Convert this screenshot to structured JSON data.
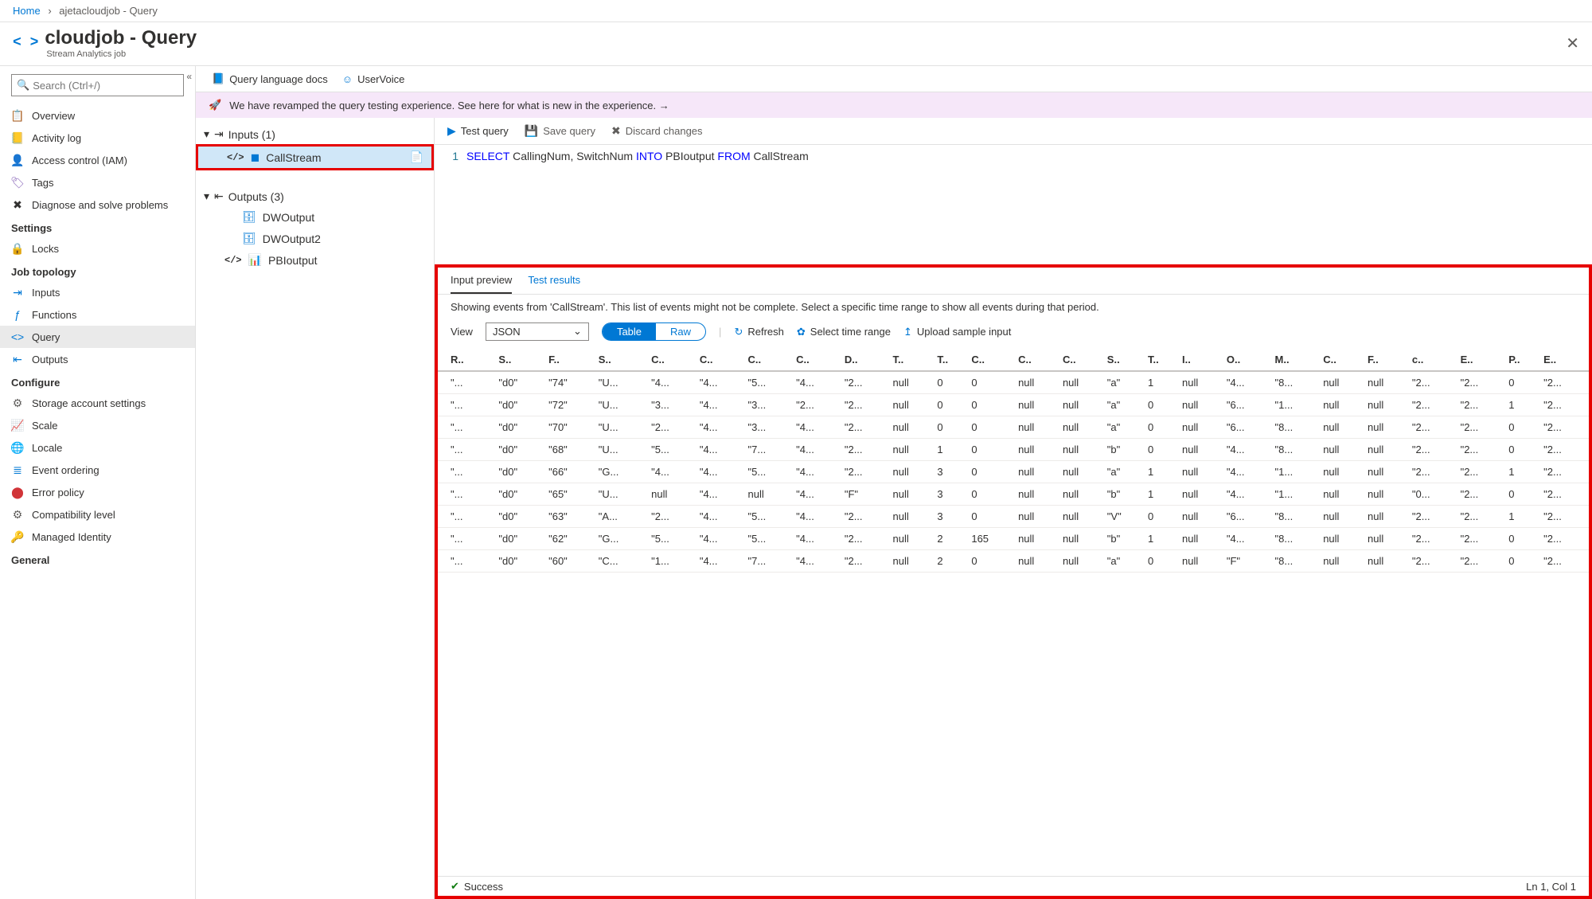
{
  "breadcrumb": {
    "home": "Home",
    "current": "ajetacloudjob - Query"
  },
  "header": {
    "title": "cloudjob - Query",
    "subtitle": "Stream Analytics job"
  },
  "sidebar": {
    "search_placeholder": "Search (Ctrl+/)",
    "items_main": [
      {
        "label": "Overview",
        "icon": "📋",
        "cls": "ic-blue"
      },
      {
        "label": "Activity log",
        "icon": "📒",
        "cls": "ic-blue"
      },
      {
        "label": "Access control (IAM)",
        "icon": "👤",
        "cls": "ic-blue"
      },
      {
        "label": "Tags",
        "icon": "🏷",
        "cls": "ic-purple"
      },
      {
        "label": "Diagnose and solve problems",
        "icon": "✖",
        "cls": "ic-dark"
      }
    ],
    "section_settings": "Settings",
    "items_settings": [
      {
        "label": "Locks",
        "icon": "🔒",
        "cls": "ic-dark"
      }
    ],
    "section_topology": "Job topology",
    "items_topology": [
      {
        "label": "Inputs",
        "icon": "⇥",
        "cls": "ic-blue"
      },
      {
        "label": "Functions",
        "icon": "ƒ",
        "cls": "ic-blue"
      },
      {
        "label": "Query",
        "icon": "<>",
        "cls": "ic-blue",
        "active": true
      },
      {
        "label": "Outputs",
        "icon": "⇤",
        "cls": "ic-blue"
      }
    ],
    "section_configure": "Configure",
    "items_configure": [
      {
        "label": "Storage account settings",
        "icon": "⚙",
        "cls": "ic-gray"
      },
      {
        "label": "Scale",
        "icon": "📈",
        "cls": "ic-blue"
      },
      {
        "label": "Locale",
        "icon": "🌐",
        "cls": "ic-teal"
      },
      {
        "label": "Event ordering",
        "icon": "≣",
        "cls": "ic-blue"
      },
      {
        "label": "Error policy",
        "icon": "⬤",
        "cls": "ic-red"
      },
      {
        "label": "Compatibility level",
        "icon": "⚙",
        "cls": "ic-gray"
      },
      {
        "label": "Managed Identity",
        "icon": "🔑",
        "cls": "ic-yellow"
      }
    ],
    "section_general": "General"
  },
  "top_toolbar": {
    "docs": "Query language docs",
    "uservoice": "UserVoice"
  },
  "banner": "We have revamped the query testing experience. See here for what is new in the experience. →",
  "tree": {
    "inputs_label": "Inputs (1)",
    "inputs": [
      {
        "label": "CallStream",
        "selected": true
      }
    ],
    "outputs_label": "Outputs (3)",
    "outputs": [
      {
        "label": "DWOutput",
        "icon": "🗄"
      },
      {
        "label": "DWOutput2",
        "icon": "🗄"
      },
      {
        "label": "PBIoutput",
        "icon": "📊",
        "code": true
      }
    ]
  },
  "editor": {
    "actions": {
      "test": "Test query",
      "save": "Save query",
      "discard": "Discard changes"
    },
    "line_no": "1",
    "kw_select": "SELECT",
    "fields": " CallingNum, SwitchNum ",
    "kw_into": "INTO",
    "target": " PBIoutput ",
    "kw_from": "FROM",
    "source": " CallStream"
  },
  "results": {
    "tab_input": "Input preview",
    "tab_test": "Test results",
    "message": "Showing events from 'CallStream'. This list of events might not be complete. Select a specific time range to show all events during that period.",
    "view_label": "View",
    "view_value": "JSON",
    "toggle_table": "Table",
    "toggle_raw": "Raw",
    "refresh": "Refresh",
    "time_range": "Select time range",
    "upload": "Upload sample input",
    "columns": [
      "R..",
      "S..",
      "F..",
      "S..",
      "C..",
      "C..",
      "C..",
      "C..",
      "D..",
      "T..",
      "T..",
      "C..",
      "C..",
      "C..",
      "S..",
      "T..",
      "I..",
      "O..",
      "M..",
      "C..",
      "F..",
      "c..",
      "E..",
      "P..",
      "E.."
    ],
    "rows": [
      [
        "\"...",
        "\"d0\"",
        "\"74\"",
        "\"U...",
        "\"4...",
        "\"4...",
        "\"5...",
        "\"4...",
        "\"2...",
        "null",
        "0",
        "0",
        "null",
        "null",
        "\"a\"",
        "1",
        "null",
        "\"4...",
        "\"8...",
        "null",
        "null",
        "\"2...",
        "\"2...",
        "0",
        "\"2..."
      ],
      [
        "\"...",
        "\"d0\"",
        "\"72\"",
        "\"U...",
        "\"3...",
        "\"4...",
        "\"3...",
        "\"2...",
        "\"2...",
        "null",
        "0",
        "0",
        "null",
        "null",
        "\"a\"",
        "0",
        "null",
        "\"6...",
        "\"1...",
        "null",
        "null",
        "\"2...",
        "\"2...",
        "1",
        "\"2..."
      ],
      [
        "\"...",
        "\"d0\"",
        "\"70\"",
        "\"U...",
        "\"2...",
        "\"4...",
        "\"3...",
        "\"4...",
        "\"2...",
        "null",
        "0",
        "0",
        "null",
        "null",
        "\"a\"",
        "0",
        "null",
        "\"6...",
        "\"8...",
        "null",
        "null",
        "\"2...",
        "\"2...",
        "0",
        "\"2..."
      ],
      [
        "\"...",
        "\"d0\"",
        "\"68\"",
        "\"U...",
        "\"5...",
        "\"4...",
        "\"7...",
        "\"4...",
        "\"2...",
        "null",
        "1",
        "0",
        "null",
        "null",
        "\"b\"",
        "0",
        "null",
        "\"4...",
        "\"8...",
        "null",
        "null",
        "\"2...",
        "\"2...",
        "0",
        "\"2..."
      ],
      [
        "\"...",
        "\"d0\"",
        "\"66\"",
        "\"G...",
        "\"4...",
        "\"4...",
        "\"5...",
        "\"4...",
        "\"2...",
        "null",
        "3",
        "0",
        "null",
        "null",
        "\"a\"",
        "1",
        "null",
        "\"4...",
        "\"1...",
        "null",
        "null",
        "\"2...",
        "\"2...",
        "1",
        "\"2..."
      ],
      [
        "\"...",
        "\"d0\"",
        "\"65\"",
        "\"U...",
        "null",
        "\"4...",
        "null",
        "\"4...",
        "\"F\"",
        "null",
        "3",
        "0",
        "null",
        "null",
        "\"b\"",
        "1",
        "null",
        "\"4...",
        "\"1...",
        "null",
        "null",
        "\"0...",
        "\"2...",
        "0",
        "\"2..."
      ],
      [
        "\"...",
        "\"d0\"",
        "\"63\"",
        "\"A...",
        "\"2...",
        "\"4...",
        "\"5...",
        "\"4...",
        "\"2...",
        "null",
        "3",
        "0",
        "null",
        "null",
        "\"V\"",
        "0",
        "null",
        "\"6...",
        "\"8...",
        "null",
        "null",
        "\"2...",
        "\"2...",
        "1",
        "\"2..."
      ],
      [
        "\"...",
        "\"d0\"",
        "\"62\"",
        "\"G...",
        "\"5...",
        "\"4...",
        "\"5...",
        "\"4...",
        "\"2...",
        "null",
        "2",
        "165",
        "null",
        "null",
        "\"b\"",
        "1",
        "null",
        "\"4...",
        "\"8...",
        "null",
        "null",
        "\"2...",
        "\"2...",
        "0",
        "\"2..."
      ],
      [
        "\"...",
        "\"d0\"",
        "\"60\"",
        "\"C...",
        "\"1...",
        "\"4...",
        "\"7...",
        "\"4...",
        "\"2...",
        "null",
        "2",
        "0",
        "null",
        "null",
        "\"a\"",
        "0",
        "null",
        "\"F\"",
        "\"8...",
        "null",
        "null",
        "\"2...",
        "\"2...",
        "0",
        "\"2..."
      ]
    ],
    "status": "Success",
    "cursor": "Ln 1, Col 1"
  }
}
